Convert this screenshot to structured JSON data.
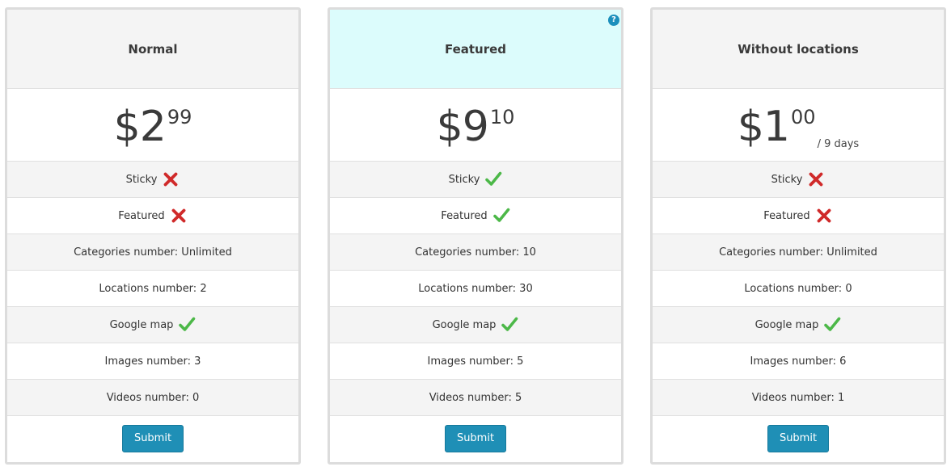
{
  "plans": [
    {
      "title": "Normal",
      "featured": false,
      "price": {
        "currency": "$",
        "whole": "2",
        "cents": "99",
        "period": ""
      },
      "features": [
        {
          "label": "Sticky",
          "value": "",
          "mark": "cross-icon"
        },
        {
          "label": "Featured",
          "value": "",
          "mark": "cross-icon"
        },
        {
          "label": "Categories number: Unlimited",
          "value": "",
          "mark": ""
        },
        {
          "label": "Locations number: 2",
          "value": "",
          "mark": ""
        },
        {
          "label": "Google map",
          "value": "",
          "mark": "check-icon"
        },
        {
          "label": "Images number: 3",
          "value": "",
          "mark": ""
        },
        {
          "label": "Videos number: 0",
          "value": "",
          "mark": ""
        }
      ],
      "submit_label": "Submit"
    },
    {
      "title": "Featured",
      "featured": true,
      "help_icon": "?",
      "price": {
        "currency": "$",
        "whole": "9",
        "cents": "10",
        "period": ""
      },
      "features": [
        {
          "label": "Sticky",
          "value": "",
          "mark": "check-icon"
        },
        {
          "label": "Featured",
          "value": "",
          "mark": "check-icon"
        },
        {
          "label": "Categories number: 10",
          "value": "",
          "mark": ""
        },
        {
          "label": "Locations number: 30",
          "value": "",
          "mark": ""
        },
        {
          "label": "Google map",
          "value": "",
          "mark": "check-icon"
        },
        {
          "label": "Images number: 5",
          "value": "",
          "mark": ""
        },
        {
          "label": "Videos number: 5",
          "value": "",
          "mark": ""
        }
      ],
      "submit_label": "Submit"
    },
    {
      "title": "Without locations",
      "featured": false,
      "price": {
        "currency": "$",
        "whole": "1",
        "cents": "00",
        "period": "/ 9 days"
      },
      "features": [
        {
          "label": "Sticky",
          "value": "",
          "mark": "cross-icon"
        },
        {
          "label": "Featured",
          "value": "",
          "mark": "cross-icon"
        },
        {
          "label": "Categories number: Unlimited",
          "value": "",
          "mark": ""
        },
        {
          "label": "Locations number: 0",
          "value": "",
          "mark": ""
        },
        {
          "label": "Google map",
          "value": "",
          "mark": "check-icon"
        },
        {
          "label": "Images number: 6",
          "value": "",
          "mark": ""
        },
        {
          "label": "Videos number: 1",
          "value": "",
          "mark": ""
        }
      ],
      "submit_label": "Submit"
    }
  ],
  "colors": {
    "header_bg": "#f4f4f4",
    "featured_header_bg": "#dcfcfc",
    "alt_row_bg": "#f4f4f4",
    "button_bg": "#1f8fb6",
    "check": "#4cb848",
    "cross": "#d02a2a",
    "help_icon": "#1b8fbc"
  }
}
